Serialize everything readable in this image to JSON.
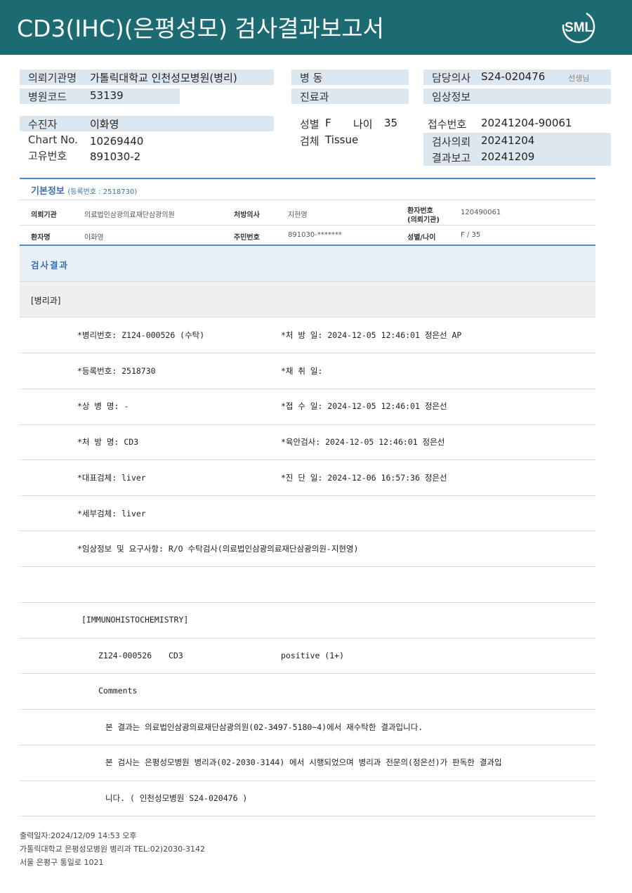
{
  "header": {
    "title": "CD3(IHC)(은평성모) 검사결과보고서",
    "logo_text": "SML",
    "bg_color": "#1c6b73"
  },
  "info": {
    "requester_label": "의뢰기관명",
    "requester_value": "가톨릭대학교 인천성모병원(병리)",
    "hospital_code_label": "병원코드",
    "hospital_code_value": "53139",
    "ward_label": "병 동",
    "dept_label": "진료과",
    "doctor_label": "담당의사",
    "doctor_value": "S24-020476",
    "doctor_suffix": "선생님",
    "clinical_label": "임상정보",
    "patient_label": "수진자",
    "patient_value": "이화영",
    "chart_label": "Chart No.",
    "chart_value": "10269440",
    "unique_label": "고유번호",
    "unique_value": "891030-2",
    "sex_label": "성별",
    "sex_value": "F",
    "age_label": "나이",
    "age_value": "35",
    "specimen_label": "검체",
    "specimen_value": "Tissue",
    "receipt_label": "접수번호",
    "receipt_value": "20241204-90061",
    "request_label": "검사의뢰",
    "request_value": "20241204",
    "report_label": "결과보고",
    "report_value": "20241209"
  },
  "basic": {
    "title": "기본정보",
    "reg": "(등록번호 : 2518730)",
    "inst_label": "의뢰기관",
    "inst_value": "의료법인삼광의료재단삼광의원",
    "doctor_label": "처방의사",
    "doctor_value": "지현영",
    "patno_label_1": "환자번호",
    "patno_label_2": "(의뢰기관)",
    "patno_value": "120490061",
    "name_label": "환자명",
    "name_value": "이화영",
    "rrn_label": "주민번호",
    "rrn_value": "891030-*******",
    "sexage_label": "성별/나이",
    "sexage_value": "F / 35"
  },
  "result": {
    "title": "검사결과",
    "dept": "[병리과]",
    "rows": [
      {
        "left": "*병리번호: Z124-000526 (수탁)",
        "right": "*처 방 일: 2024-12-05 12:46:01  정은선 AP"
      },
      {
        "left": "*등록번호: 2518730",
        "right": "*채 취 일:"
      },
      {
        "left": "*상 병 명: -",
        "right": "*접 수 일: 2024-12-05 12:46:01  정은선"
      },
      {
        "left": "*처 방 명: CD3",
        "right": "*육안검사: 2024-12-05 12:46:01  정은선"
      },
      {
        "left": "*대표검체: liver",
        "right": "*진 단 일: 2024-12-06 16:57:36  정은선"
      },
      {
        "left": "*세부검체: liver",
        "right": ""
      }
    ],
    "clinical_note": "*임상정보 및 요구사항: R/O 수탁검사(의료법인삼광의료재단삼광의원-지현영)",
    "ihc_header": "[IMMUNOHISTOCHEMISTRY]",
    "ihc_no": "Z124-000526",
    "ihc_marker": "CD3",
    "ihc_result": "positive (1+)",
    "comments_label": "Comments",
    "comment_1": "본 결과는 의료법인삼광의료재단삼광의원(02-3497-5180~4)에서 재수탁한 결과입니다.",
    "comment_2": "본 검사는 은평성모병원 병리과(02-2030-3144) 에서 시행되었으며 병리과 전문의(정은선)가 판독한 결과입",
    "comment_3": "니다. ( 인천성모병원 S24-020476 )"
  },
  "footer": {
    "line1": "출력일자:2024/12/09 14:53 오후",
    "line2": "가톨릭대학교 은평성모병원 병리과 TEL:02)2030-3142",
    "line3": "서울 은평구 통일로 1021"
  }
}
